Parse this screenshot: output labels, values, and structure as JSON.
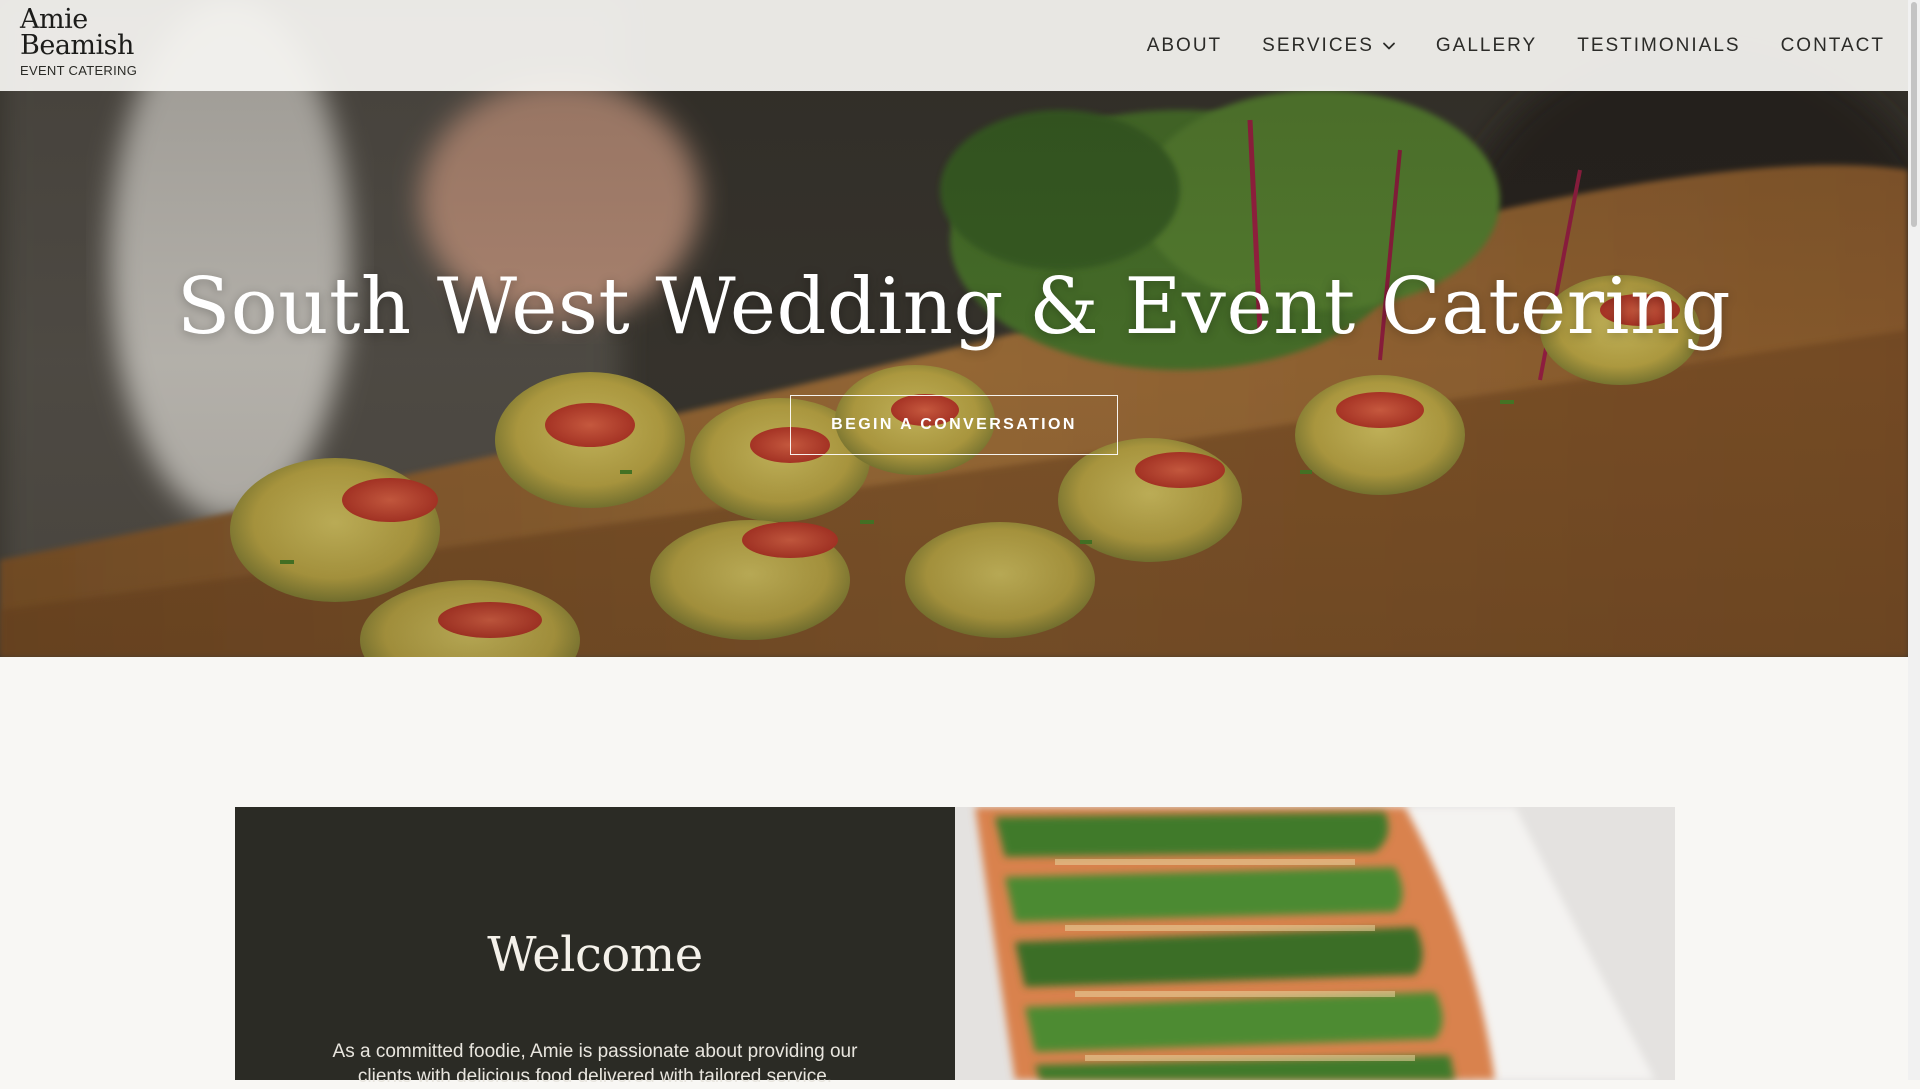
{
  "brand": {
    "name_line1": "Amie",
    "name_line2": "Beamish",
    "tagline": "EVENT CATERING"
  },
  "nav": {
    "items": [
      {
        "label": "ABOUT"
      },
      {
        "label": "SERVICES",
        "has_dropdown": true,
        "icon": "chevron-down-icon"
      },
      {
        "label": "GALLERY"
      },
      {
        "label": "TESTIMONIALS"
      },
      {
        "label": "CONTACT"
      }
    ]
  },
  "hero": {
    "title": "South West Wedding & Event Catering",
    "cta_label": "BEGIN A CONVERSATION"
  },
  "welcome": {
    "heading": "Welcome",
    "text": "As a committed foodie, Amie is passionate about providing our clients with delicious food delivered with tailored service."
  },
  "colors": {
    "header_bg": "#f6f5f2",
    "page_bg": "#f8f7f4",
    "welcome_panel_bg": "#2b2b25",
    "hero_text": "#ffffff"
  }
}
